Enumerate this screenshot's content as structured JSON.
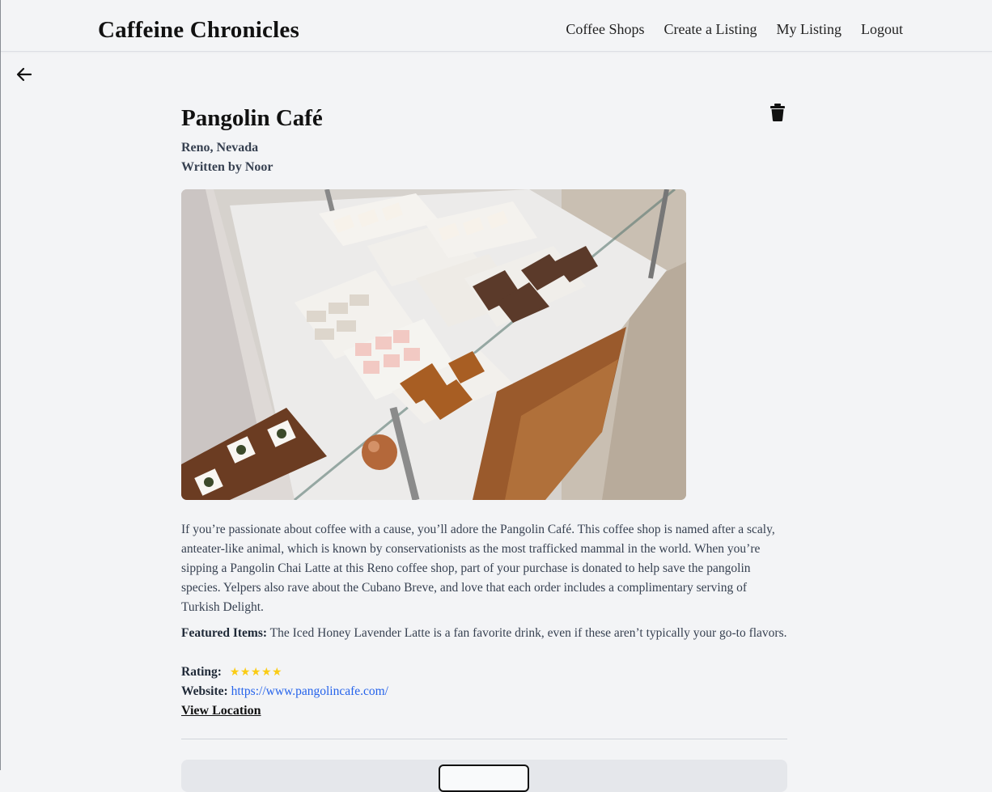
{
  "nav": {
    "brand": "Caffeine Chronicles",
    "links": [
      "Coffee Shops",
      "Create a Listing",
      "My Listing",
      "Logout"
    ]
  },
  "post": {
    "title": "Pangolin Café",
    "location": "Reno, Nevada",
    "author": "Written by Noor",
    "description": "If you’re passionate about coffee with a cause, you’ll adore the Pangolin Café. This coffee shop is named after a scaly, anteater-like animal, which is known by conservationists as the most trafficked mammal in the world. When you’re sipping a Pangolin Chai Latte at this Reno coffee shop, part of your purchase is donated to help save the pangolin species. Yelpers also rave about the Cubano Breve, and love that each order includes a complimentary serving of Turkish Delight.",
    "featured_label": "Featured Items:",
    "featured_text": "The Iced Honey Lavender Latte is a fan favorite drink, even if these aren’t typically your go-to flavors.",
    "rating_label": "Rating:",
    "rating_value": 5,
    "rating_stars": "★★★★★",
    "website_label": "Website:",
    "website_url": "https://www.pangolincafe.com/",
    "view_location": "View Location"
  },
  "icons": {
    "back": "arrow-left-icon",
    "delete": "trash-icon",
    "star": "star-icon"
  },
  "colors": {
    "background": "#f3f4f6",
    "star": "#facc15",
    "link": "#2563eb"
  }
}
